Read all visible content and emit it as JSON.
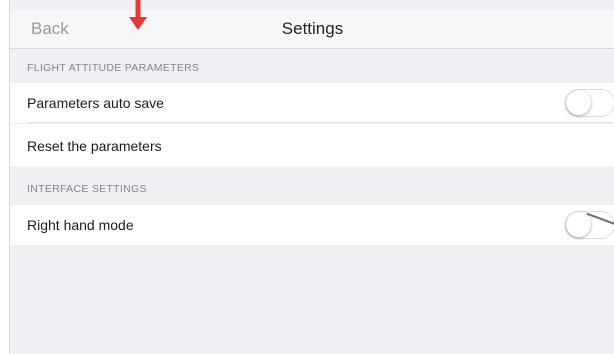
{
  "navbar": {
    "back_label": "Back",
    "title": "Settings"
  },
  "sections": {
    "flight": {
      "header": "FLIGHT ATTITUDE PARAMETERS",
      "auto_save_label": "Parameters auto save",
      "auto_save_on": false,
      "reset_label": "Reset the parameters"
    },
    "interface": {
      "header": "INTERFACE SETTINGS",
      "right_hand_label": "Right hand mode",
      "right_hand_on": false
    }
  },
  "colors": {
    "annotation_arrow": "#e53935",
    "background": "#efeff4"
  }
}
